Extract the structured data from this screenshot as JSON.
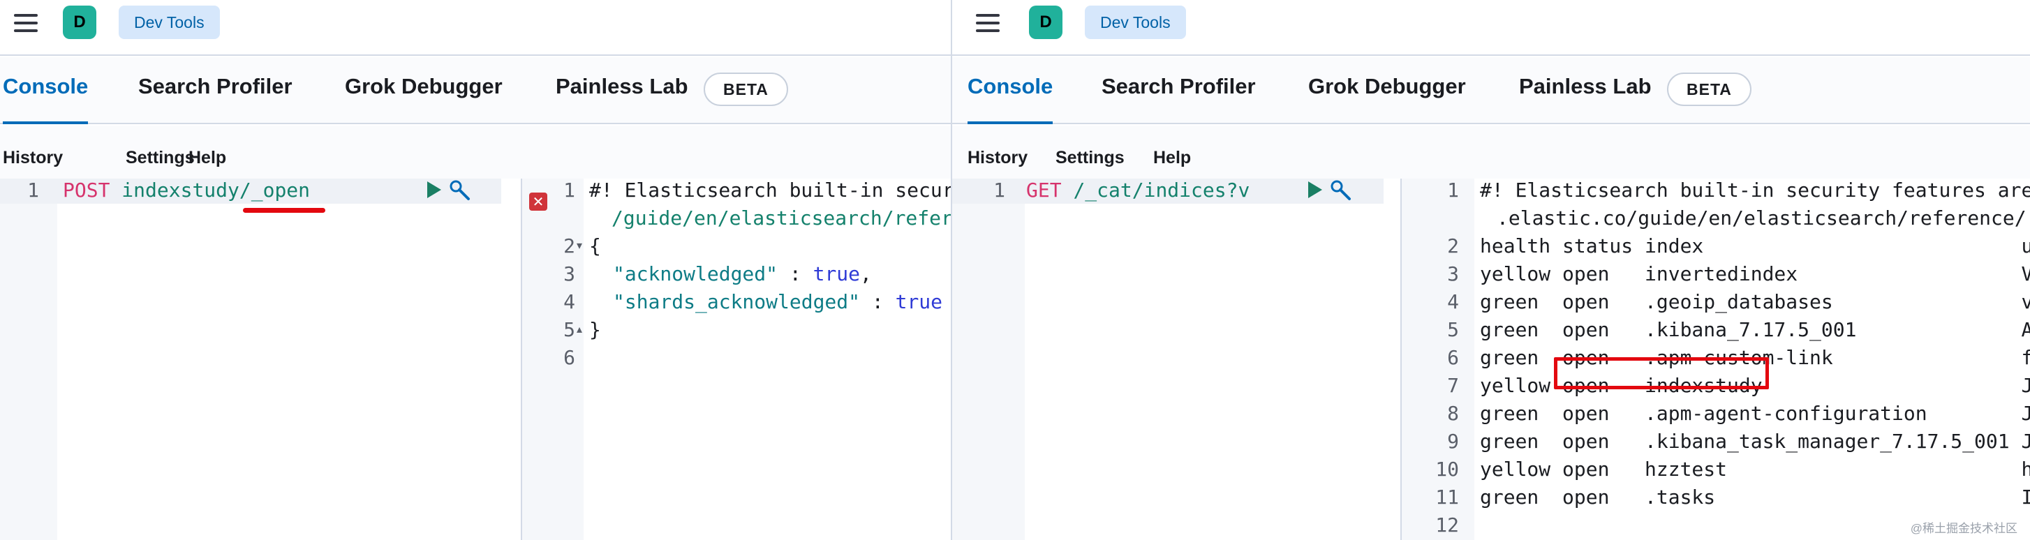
{
  "left": {
    "header": {
      "avatar_letter": "D",
      "app_name": "Dev Tools"
    },
    "tabs": [
      {
        "label": "Console",
        "active": true
      },
      {
        "label": "Search Profiler",
        "active": false
      },
      {
        "label": "Grok Debugger",
        "active": false
      },
      {
        "label": "Painless Lab",
        "active": false
      }
    ],
    "beta_label": "BETA",
    "subnav": [
      "History",
      "Settings",
      "Help"
    ],
    "request": {
      "line_number": "1",
      "method": "POST",
      "path": "indexstudy/_open"
    },
    "response": {
      "line_numbers": [
        "1",
        "",
        "2",
        "3",
        "4",
        "5",
        "6"
      ],
      "comment_line1": "#! Elasticsearch built-in secur",
      "comment_line2": "/guide/en/elasticsearch/refer",
      "open_brace": "{",
      "key1": "\"acknowledged\"",
      "sep1": " : ",
      "val1": "true",
      "comma1": ",",
      "key2": "\"shards_acknowledged\"",
      "sep2": " : ",
      "val2": "true",
      "close_brace": "}",
      "error_glyph": "✕"
    }
  },
  "right": {
    "header": {
      "avatar_letter": "D",
      "app_name": "Dev Tools"
    },
    "tabs": [
      {
        "label": "Console",
        "active": true
      },
      {
        "label": "Search Profiler",
        "active": false
      },
      {
        "label": "Grok Debugger",
        "active": false
      },
      {
        "label": "Painless Lab",
        "active": false
      }
    ],
    "beta_label": "BETA",
    "subnav": [
      "History",
      "Settings",
      "Help"
    ],
    "request": {
      "line_number": "1",
      "method": "GET",
      "path": "/_cat/indices?v"
    },
    "response": {
      "comment_line1": "#! Elasticsearch built-in security features are",
      "comment_line2": ".elastic.co/guide/en/elasticsearch/reference/",
      "rows": [
        {
          "n": "2",
          "text": "health status index                           u"
        },
        {
          "n": "3",
          "text": "yellow open   invertedindex                   V"
        },
        {
          "n": "4",
          "text": "green  open   .geoip_databases                v"
        },
        {
          "n": "5",
          "text": "green  open   .kibana_7.17.5_001              A"
        },
        {
          "n": "6",
          "text": "green  open   .apm-custom-link                f"
        },
        {
          "n": "7",
          "text": "yellow open   indexstudy                      J"
        },
        {
          "n": "8",
          "text": "green  open   .apm-agent-configuration        J"
        },
        {
          "n": "9",
          "text": "green  open   .kibana_task_manager_7.17.5_001 J"
        },
        {
          "n": "10",
          "text": "yellow open   hzztest                         h"
        },
        {
          "n": "11",
          "text": "green  open   .tasks                          I"
        },
        {
          "n": "12",
          "text": ""
        }
      ]
    }
  },
  "watermark": "@稀土掘金技术社区"
}
